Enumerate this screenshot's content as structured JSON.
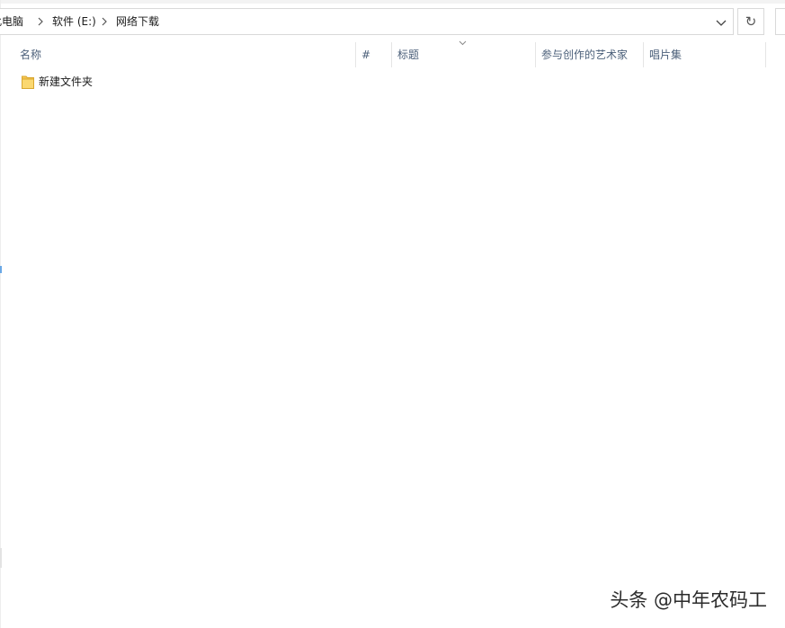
{
  "breadcrumb": {
    "items": [
      "此电脑",
      "软件 (E:)",
      "网络下载"
    ]
  },
  "columns": [
    "名称",
    "#",
    "标题",
    "参与创作的艺术家",
    "唱片集"
  ],
  "files": [
    {
      "name": "新建文件夹",
      "icon": "folder-icon"
    }
  ],
  "toolbar": {
    "refresh_glyph": "↻"
  },
  "watermark": "头条 @中年农码工",
  "colors": {
    "folder": "#f5c451",
    "header_text": "#4c607a",
    "border": "#d9d9d9"
  }
}
